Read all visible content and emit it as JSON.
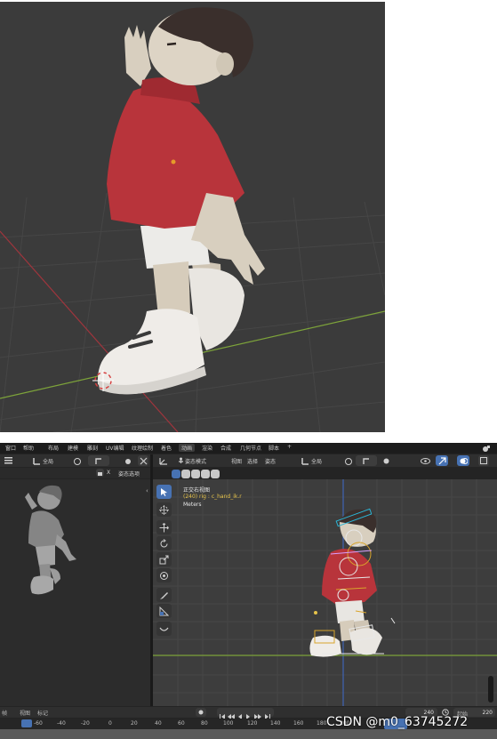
{
  "menu": {
    "items": [
      "窗口",
      "帮助",
      "布局",
      "建模",
      "雕刻",
      "UV编辑",
      "纹理绘制",
      "着色",
      "动画",
      "渲染",
      "合成",
      "几何节点",
      "脚本",
      "+"
    ],
    "active": "动画"
  },
  "left_header": {
    "global_label": "全局",
    "options_label": "姿态选项",
    "x_label": "X"
  },
  "main_header": {
    "mode_label": "姿态模式",
    "view_label": "视图",
    "select_label": "选择",
    "pose_label": "姿态",
    "global_label": "全局"
  },
  "viewport_info": {
    "view_name": "正交右视图",
    "object_line": "(240) rig : c_hand_ik.r",
    "units": "Meters"
  },
  "timeline": {
    "view_label": "视图",
    "marker_label": "标记",
    "ticks": [
      "-60",
      "-40",
      "-20",
      "0",
      "20",
      "40",
      "60",
      "80",
      "100",
      "120",
      "140",
      "160",
      "180",
      "200"
    ],
    "current_frame": "240",
    "start_label": "起始",
    "start_value": "220",
    "partial_label": "帧"
  },
  "watermark": "CSDN @m0_63745272",
  "colors": {
    "viewport_bg": "#3b3b3b",
    "ui_bg": "#242424",
    "accent": "#4772b3",
    "hoodie": "#b8343b",
    "skin": "#d8cfbf",
    "hair": "#3a2f2c",
    "shoe": "#e9e6e1",
    "info_yellow": "#e6c34a",
    "x_axis": "#a0353d",
    "y_axis": "#7da33a"
  },
  "icons": [
    "select-box-icon",
    "cursor-icon",
    "move-icon",
    "rotate-icon",
    "scale-icon",
    "transform-icon",
    "annotate-icon",
    "measure-icon",
    "relax-icon",
    "play-icon",
    "jump-start-icon",
    "jump-end-icon",
    "keyframe-prev-icon",
    "keyframe-next-icon",
    "clock-icon"
  ]
}
